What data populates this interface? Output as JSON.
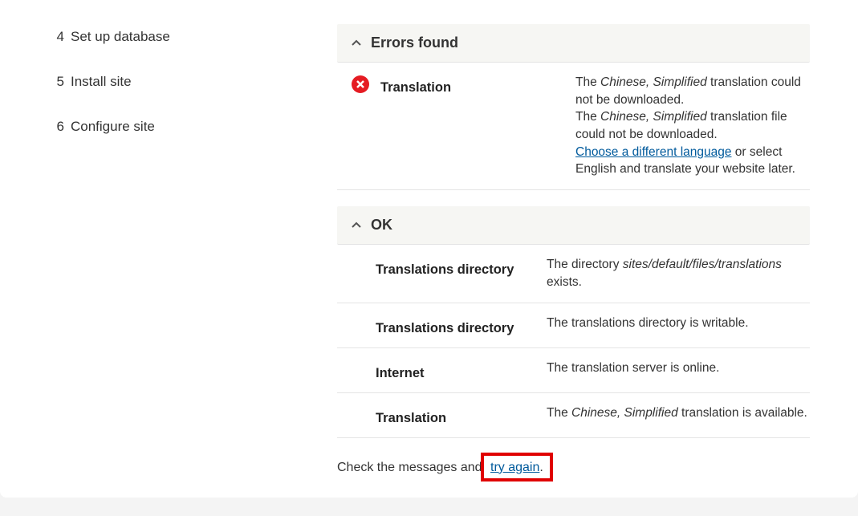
{
  "sidebar": {
    "steps": [
      {
        "num": "4",
        "label": "Set up database"
      },
      {
        "num": "5",
        "label": "Install site"
      },
      {
        "num": "6",
        "label": "Configure site"
      }
    ]
  },
  "sections": {
    "errors": {
      "title": "Errors found",
      "items": [
        {
          "label": "Translation",
          "desc_parts": {
            "p1a": "The ",
            "p1b": "Chinese, Simplified",
            "p1c": " translation could not be downloaded.",
            "p2a": "The ",
            "p2b": "Chinese, Simplified",
            "p2c": " translation file could not be downloaded.",
            "link": "Choose a different language",
            "p3": " or select English and translate your website later."
          }
        }
      ]
    },
    "ok": {
      "title": "OK",
      "items": [
        {
          "label": "Translations directory",
          "desc_a": "The directory ",
          "desc_em": "sites/default/files/translations",
          "desc_b": " exists."
        },
        {
          "label": "Translations directory",
          "desc": "The translations directory is writable."
        },
        {
          "label": "Internet",
          "desc": "The translation server is online."
        },
        {
          "label": "Translation",
          "desc_a": "The ",
          "desc_em": "Chinese, Simplified",
          "desc_b": " translation is available."
        }
      ]
    }
  },
  "footer": {
    "prefix": "Check the messages and ",
    "link": "try again",
    "suffix": "."
  }
}
